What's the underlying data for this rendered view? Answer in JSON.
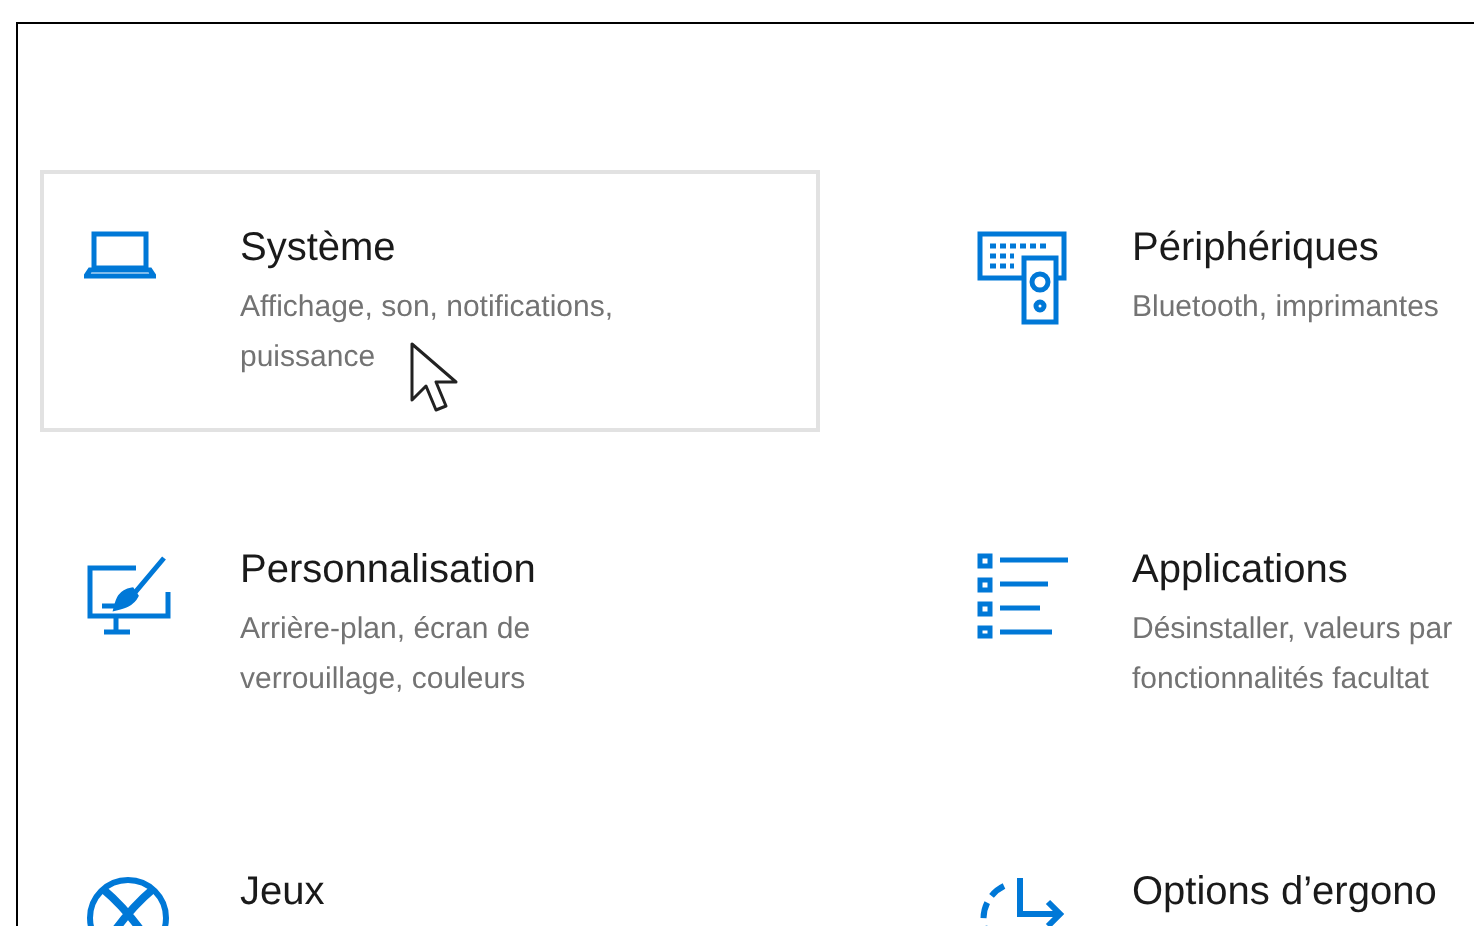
{
  "categories": [
    {
      "kind": "laptop",
      "title": "Système",
      "description_lines": [
        "Affichage, son, notifications,",
        "puissance"
      ],
      "hovered": true
    },
    {
      "kind": "devices",
      "title": "Périphériques",
      "description_lines": [
        "Bluetooth, imprimantes"
      ],
      "hovered": false
    },
    {
      "kind": "personalize",
      "title": "Personnalisation",
      "description_lines": [
        "Arrière-plan, écran de",
        "verrouillage, couleurs"
      ],
      "hovered": false
    },
    {
      "kind": "apps",
      "title": "Applications",
      "description_lines": [
        "Désinstaller, valeurs par",
        "fonctionnalités facultat"
      ],
      "hovered": false
    },
    {
      "kind": "gaming",
      "title": "Jeux",
      "hovered": false
    },
    {
      "kind": "ease",
      "title": "Options d’ergono",
      "hovered": false
    }
  ]
}
